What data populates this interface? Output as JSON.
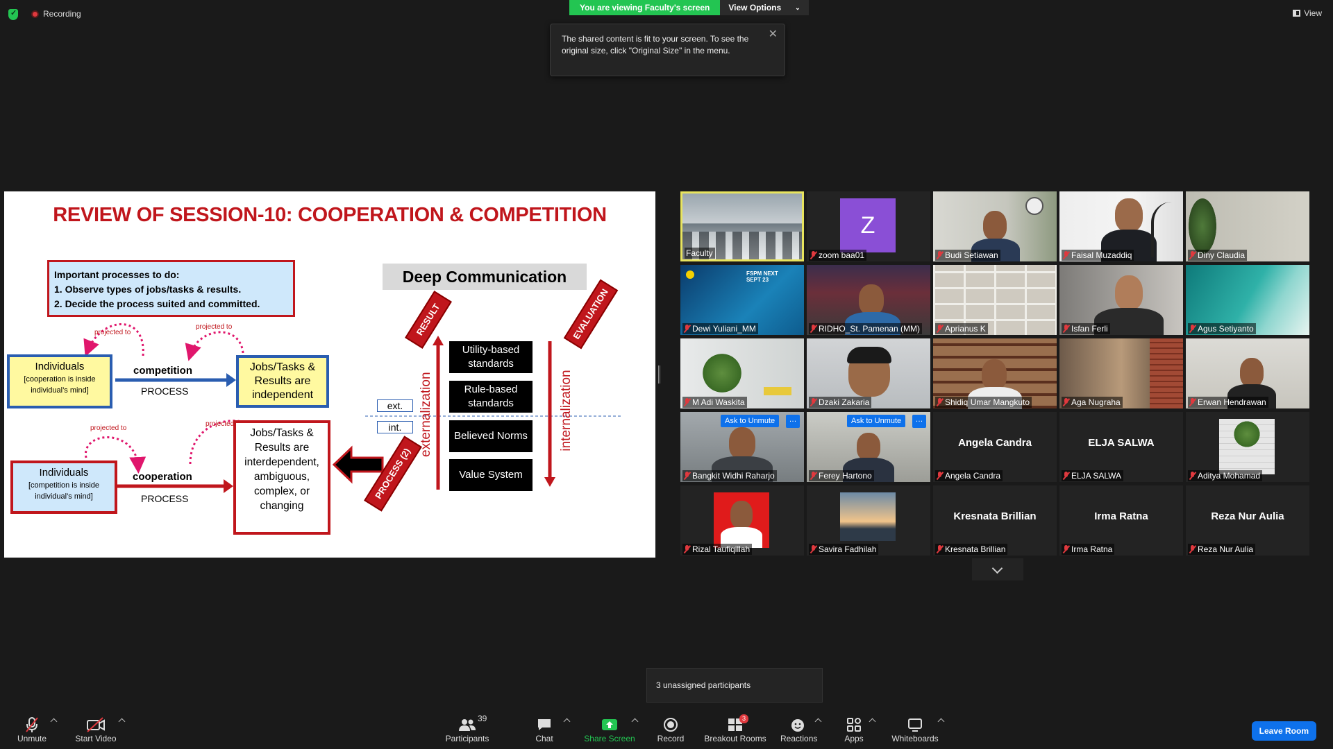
{
  "topbar": {
    "recording_label": "Recording",
    "viewing_banner": "You are viewing Faculty's screen",
    "view_options_label": "View Options",
    "view_label": "View"
  },
  "tooltip": {
    "text": "The shared content is fit to your screen. To see the original size, click \"Original Size\" in the menu."
  },
  "slide": {
    "title": "REVIEW OF SESSION-10: COOPERATION & COMPETITION",
    "processes_heading": "Important processes to do:",
    "process_1": "1.   Observe types of jobs/tasks & results.",
    "process_2": "2.   Decide the process suited and committed.",
    "individuals": "Individuals",
    "cooperation_inside": "[cooperation is inside individual’s mind]",
    "competition_inside": "[competition is inside individual’s mind]",
    "competition": "competition",
    "cooperation": "cooperation",
    "process": "PROCESS",
    "projected_to": "projected to",
    "jobs_independent": "Jobs/Tasks & Results are independent",
    "jobs_interdependent": "Jobs/Tasks & Results are interdependent, ambiguous, complex, or changing",
    "deep_communication": "Deep Communication",
    "result_tag": "RESULT",
    "evaluation_tag": "EVALUATION",
    "process2_tag": "PROCESS (2)",
    "externalization": "externalization",
    "internalization": "internalization",
    "ext": "ext.",
    "int": "int.",
    "standards": [
      "Utility-based standards",
      "Rule-based standards",
      "Believed Norms",
      "Value System"
    ]
  },
  "participants": [
    {
      "name": "Faculty",
      "muted": false,
      "active": true,
      "kind": "video"
    },
    {
      "name": "zoom baa01",
      "muted": true,
      "kind": "avatar",
      "avatar_letter": "Z"
    },
    {
      "name": "Budi Setiawan",
      "muted": true,
      "kind": "video"
    },
    {
      "name": "Faisal Muzaddiq",
      "muted": true,
      "kind": "video"
    },
    {
      "name": "Diny Claudia",
      "muted": true,
      "kind": "video"
    },
    {
      "name": "Dewi Yuliani_MM",
      "muted": true,
      "kind": "video",
      "overlay_text": "FSPM NEXT SEPT 23"
    },
    {
      "name": "RIDHO_St. Pamenan (MM)",
      "muted": true,
      "kind": "video"
    },
    {
      "name": "Aprianus K",
      "muted": true,
      "kind": "video"
    },
    {
      "name": "Isfan Ferli",
      "muted": true,
      "kind": "video"
    },
    {
      "name": "Agus Setiyanto",
      "muted": true,
      "kind": "video"
    },
    {
      "name": "M Adi Waskita",
      "muted": true,
      "kind": "video"
    },
    {
      "name": "Dzaki Zakaria",
      "muted": true,
      "kind": "video"
    },
    {
      "name": "Shidiq Umar Mangkuto",
      "muted": true,
      "kind": "video"
    },
    {
      "name": "Aga Nugraha",
      "muted": true,
      "kind": "video"
    },
    {
      "name": "Erwan Hendrawan",
      "muted": true,
      "kind": "video"
    },
    {
      "name": "Bangkit Widhi Raharjo",
      "muted": true,
      "kind": "video",
      "ask_unmute": "Ask to Unmute"
    },
    {
      "name": "Ferey Hartono",
      "muted": true,
      "kind": "video",
      "ask_unmute": "Ask to Unmute"
    },
    {
      "name": "Angela Candra",
      "muted": true,
      "kind": "name"
    },
    {
      "name": "ELJA SALWA",
      "muted": true,
      "kind": "name"
    },
    {
      "name": "Aditya Mohamad",
      "muted": true,
      "kind": "video"
    },
    {
      "name": "Rizal Taufiqillah",
      "muted": true,
      "kind": "video"
    },
    {
      "name": "Savira Fadhilah",
      "muted": true,
      "kind": "video"
    },
    {
      "name": "Kresnata Brillian",
      "muted": true,
      "kind": "name"
    },
    {
      "name": "Irma Ratna",
      "muted": true,
      "kind": "name"
    },
    {
      "name": "Reza Nur Aulia",
      "muted": true,
      "kind": "name"
    }
  ],
  "unassigned": "3 unassigned participants",
  "toolbar": {
    "unmute": "Unmute",
    "start_video": "Start Video",
    "participants": "Participants",
    "participants_count": "39",
    "chat": "Chat",
    "share_screen": "Share Screen",
    "record": "Record",
    "breakout_rooms": "Breakout Rooms",
    "breakout_badge": "3",
    "reactions": "Reactions",
    "apps": "Apps",
    "whiteboards": "Whiteboards",
    "leave_room": "Leave Room"
  },
  "colors": {
    "accent_blue": "#0e71eb",
    "share_green": "#23c552",
    "slide_red": "#c0161c",
    "muted_red": "#e0393e"
  }
}
